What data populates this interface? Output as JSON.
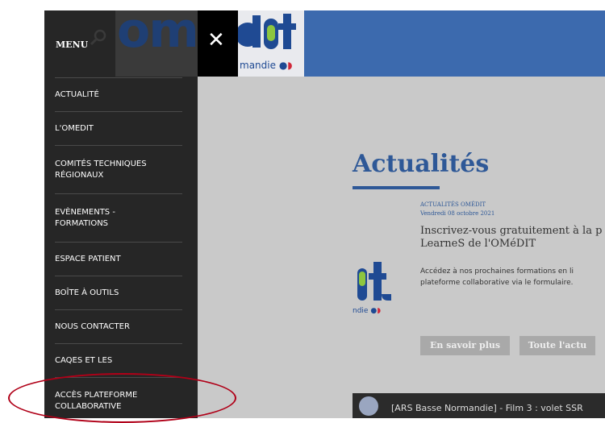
{
  "header": {
    "logo_text": "omédit",
    "logo_subtitle": "Normandie",
    "logo_partial": "mandie"
  },
  "menu": {
    "title": "MENU",
    "close_label": "✕",
    "items": [
      {
        "label": "ACTUALITÉ"
      },
      {
        "label": "L'OMEDIT"
      },
      {
        "label": "COMITÉS TECHNIQUES RÉGIONAUX"
      },
      {
        "label": "EVÈNEMENTS - FORMATIONS"
      },
      {
        "label": "ESPACE PATIENT"
      },
      {
        "label": "BOÎTE À OUTILS"
      },
      {
        "label": "NOUS CONTACTER"
      },
      {
        "label": "CAQES ET LES"
      },
      {
        "label": "ACCÈS PLATEFORME COLLABORATIVE"
      }
    ]
  },
  "main": {
    "title": "Actualités",
    "news": {
      "tag": "ACTUALITÉS OMÉDIT",
      "date": "Vendredi 08 octobre 2021",
      "title_line1": "Inscrivez-vous gratuitement à la p",
      "title_line2": "LearneS de l'OMéDIT",
      "text_line1": "Accédez à nos prochaines formations en li",
      "text_line2": "plateforme collaborative via le formulaire.",
      "logo_text": "ndie"
    },
    "buttons": {
      "more": "En savoir plus",
      "all": "Toute l'actu"
    },
    "video": {
      "title": "[ARS Basse Normandie] - Film 3 : volet SSR"
    }
  },
  "colors": {
    "menu_bg": "#262626",
    "header_blue": "#3c6aae",
    "title_blue": "#2e5897",
    "annotation_red": "#b00018"
  }
}
